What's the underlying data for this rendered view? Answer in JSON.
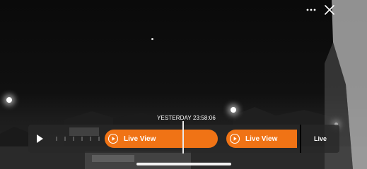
{
  "top_bar": {
    "more_icon": "more-horizontal-icon",
    "close_icon": "close-icon"
  },
  "timeline": {
    "timestamp": "YESTERDAY 23:58:06",
    "play_icon": "play-icon",
    "clips": [
      {
        "label": "Live View",
        "icon": "play-circle-icon"
      },
      {
        "label": "Live View",
        "icon": "play-circle-icon"
      }
    ],
    "live_label": "Live"
  },
  "colors": {
    "accent": "#f07315",
    "timeline_background": "#282828",
    "text": "#ffffff"
  }
}
